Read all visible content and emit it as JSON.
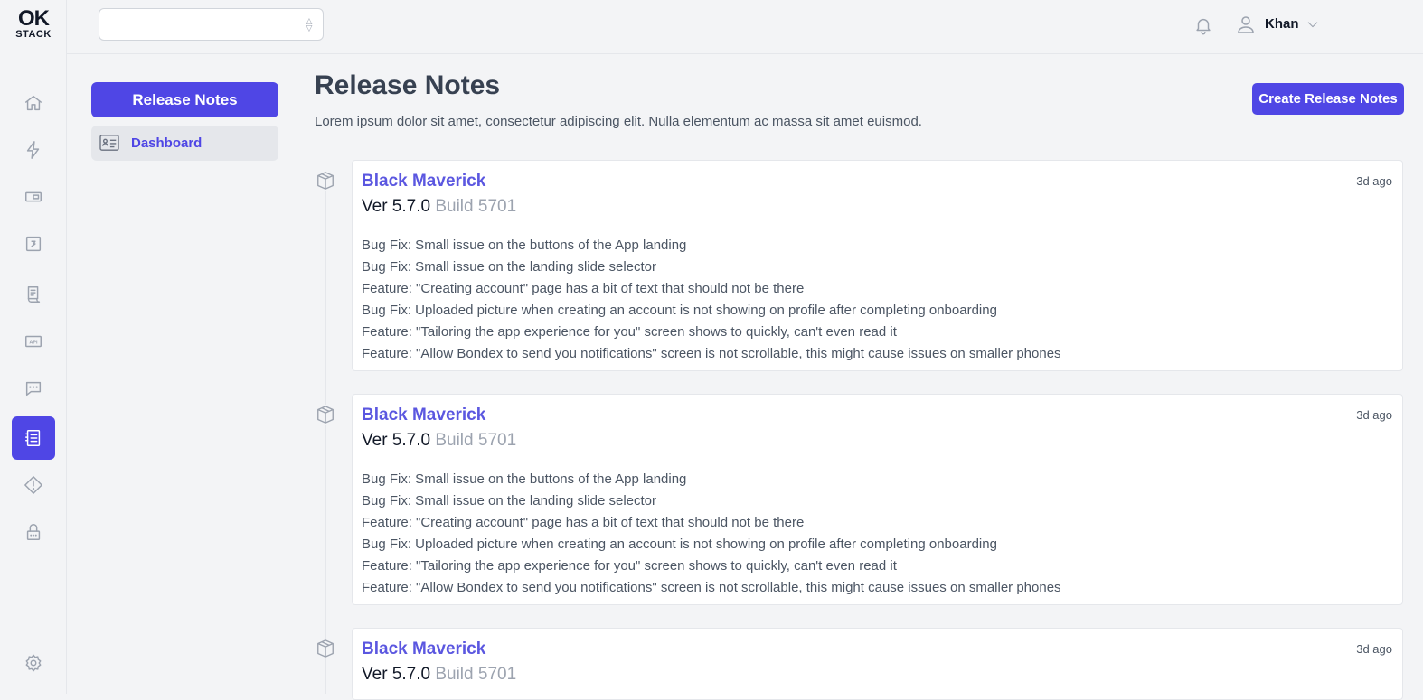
{
  "logo": {
    "line1": "OK",
    "line2": "STACK"
  },
  "rail": {
    "items": [
      {
        "name": "home-icon",
        "active": false
      },
      {
        "name": "lightning-icon",
        "active": false
      },
      {
        "name": "card-icon",
        "active": false
      },
      {
        "name": "calendar-icon",
        "active": false
      },
      {
        "name": "document-icon",
        "active": false
      },
      {
        "name": "api-icon",
        "active": false
      },
      {
        "name": "chat-icon",
        "active": false
      },
      {
        "name": "release-notes-icon",
        "active": true
      },
      {
        "name": "alert-icon",
        "active": false
      },
      {
        "name": "lock-icon",
        "active": false
      }
    ],
    "api_badge": "API"
  },
  "topbar": {
    "project_select_value": "",
    "user_name": "Khan"
  },
  "sidebar": {
    "title": "Release Notes",
    "items": [
      {
        "label": "Dashboard"
      }
    ]
  },
  "main": {
    "title": "Release Notes",
    "subtitle": "Lorem ipsum dolor sit amet, consectetur adipiscing elit. Nulla elementum ac massa sit amet euismod.",
    "create_label": "Create Release Notes",
    "notes": [
      {
        "name": "Black Maverick",
        "version": "Ver 5.7.0",
        "build": "Build 5701",
        "time": "3d ago",
        "items": [
          "Bug Fix: Small issue on the buttons of the App landing",
          "Bug Fix: Small issue on the landing slide selector",
          "Feature: \"Creating account\" page has a bit of text that should not be there",
          "Bug Fix: Uploaded picture when creating an account is not showing on profile after completing onboarding",
          "Feature: \"Tailoring the app experience for you\" screen shows to quickly, can't even read it",
          "Feature: \"Allow Bondex to send you notifications\" screen is not scrollable, this might cause issues on smaller phones"
        ]
      },
      {
        "name": "Black Maverick",
        "version": "Ver 5.7.0",
        "build": "Build 5701",
        "time": "3d ago",
        "items": [
          "Bug Fix: Small issue on the buttons of the App landing",
          "Bug Fix: Small issue on the landing slide selector",
          "Feature: \"Creating account\" page has a bit of text that should not be there",
          "Bug Fix: Uploaded picture when creating an account is not showing on profile after completing onboarding",
          "Feature: \"Tailoring the app experience for you\" screen shows to quickly, can't even read it",
          "Feature: \"Allow Bondex to send you notifications\" screen is not scrollable, this might cause issues on smaller phones"
        ]
      },
      {
        "name": "Black Maverick",
        "version": "Ver 5.7.0",
        "build": "Build 5701",
        "time": "3d ago",
        "items": []
      }
    ]
  }
}
